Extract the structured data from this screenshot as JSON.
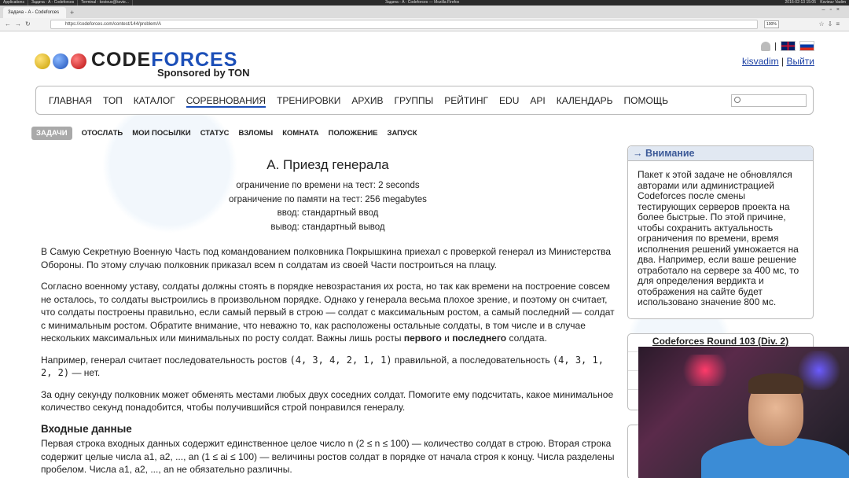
{
  "os": {
    "tasks": [
      "Applications",
      "Задача - A - Codeforces",
      "Terminal - ksvieuv@ksvie..."
    ],
    "window_title": "Задача - A - Codeforces — Mozilla Firefox",
    "clock": "2016-02-13 15:05",
    "user": "Ksvieuv Vadim"
  },
  "browser": {
    "tab_title": "Задача - A - Codeforces",
    "url": "https://codeforces.com/contest/144/problem/A",
    "zoom": "100%"
  },
  "header": {
    "logo_main": "CODE",
    "logo_accent": "FORCES",
    "sponsor": "Sponsored by TON",
    "username": "kisvadim",
    "separator": "|",
    "logout": "Выйти"
  },
  "menu": [
    {
      "label": "ГЛАВНАЯ"
    },
    {
      "label": "ТОП"
    },
    {
      "label": "КАТАЛОГ"
    },
    {
      "label": "СОРЕВНОВАНИЯ",
      "active": true
    },
    {
      "label": "ТРЕНИРОВКИ"
    },
    {
      "label": "АРХИВ"
    },
    {
      "label": "ГРУППЫ"
    },
    {
      "label": "РЕЙТИНГ"
    },
    {
      "label": "EDU"
    },
    {
      "label": "API"
    },
    {
      "label": "КАЛЕНДАРЬ"
    },
    {
      "label": "ПОМОЩЬ"
    }
  ],
  "second_menu": [
    {
      "label": "ЗАДАЧИ",
      "active": true
    },
    {
      "label": "ОТОСЛАТЬ"
    },
    {
      "label": "МОИ ПОСЫЛКИ"
    },
    {
      "label": "СТАТУС"
    },
    {
      "label": "ВЗЛОМЫ"
    },
    {
      "label": "КОМНАТА"
    },
    {
      "label": "ПОЛОЖЕНИЕ"
    },
    {
      "label": "ЗАПУСК"
    }
  ],
  "problem": {
    "title": "A. Приезд генерала",
    "time_limit": "ограничение по времени на тест: 2 seconds",
    "memory_limit": "ограничение по памяти на тест: 256 megabytes",
    "input": "ввод: стандартный ввод",
    "output": "вывод: стандартный вывод",
    "para1": "В Самую Секретную Военную Часть под командованием полковника Покрышкина приехал с проверкой генерал из Министерства Обороны. По этому случаю полковник приказал всем n солдатам из своей Части построиться на плацу.",
    "para2_a": "Согласно военному уставу, солдаты должны стоять в порядке невозрастания их роста, но так как времени на построение совсем не осталось, то солдаты выстроились в произвольном порядке. Однако у генерала весьма плохое зрение, и поэтому он считает, что солдаты построены правильно, если самый первый в строю — солдат с максимальным ростом, а самый последний — солдат с минимальным ростом. Обратите внимание, что неважно то, как расположены остальные солдаты, в том числе и в случае нескольких максимальных или минимальных по росту солдат. Важны лишь росты ",
    "para2_b1": "первого",
    "para2_and": " и ",
    "para2_b2": "последнего",
    "para2_end": " солдата.",
    "para3_a": "Например, генерал считает последовательность ростов ",
    "seq1": "(4, 3, 4, 2, 1, 1)",
    "para3_b": " правильной, а последовательность ",
    "seq2": "(4, 3, 1, 2, 2)",
    "para3_c": " — нет.",
    "para4": "За одну секунду полковник может обменять местами любых двух соседних солдат. Помогите ему подсчитать, какое минимальное количество секунд понадобится, чтобы получившийся строй понравился генералу.",
    "input_title": "Входные данные",
    "input_text": "Первая строка входных данных содержит единственное целое число n (2 ≤ n ≤ 100) — количество солдат в строю. Вторая строка содержит целые числа a1, a2, ..., an (1 ≤ ai ≤ 100) — величины ростов солдат в порядке от начала строя к концу. Числа разделены пробелом. Числа a1, a2, ..., an не обязательно различны."
  },
  "sidebar": {
    "warning_title": "→ Внимание",
    "warning_text": "Пакет к этой задаче не обновлялся авторами или администрацией Codeforces после смены тестирующих серверов проекта на более быстрые. По этой причине, чтобы сохранить актуальность ограничения по времени, время исполнения решений умножается на два. Например, если ваше решение отработало на сервере за 400 мс, то для определения вердикта и отображения на сайте будет использовано значение 800 мс.",
    "round_title": "Codeforces Round 103 (Div. 2)"
  }
}
